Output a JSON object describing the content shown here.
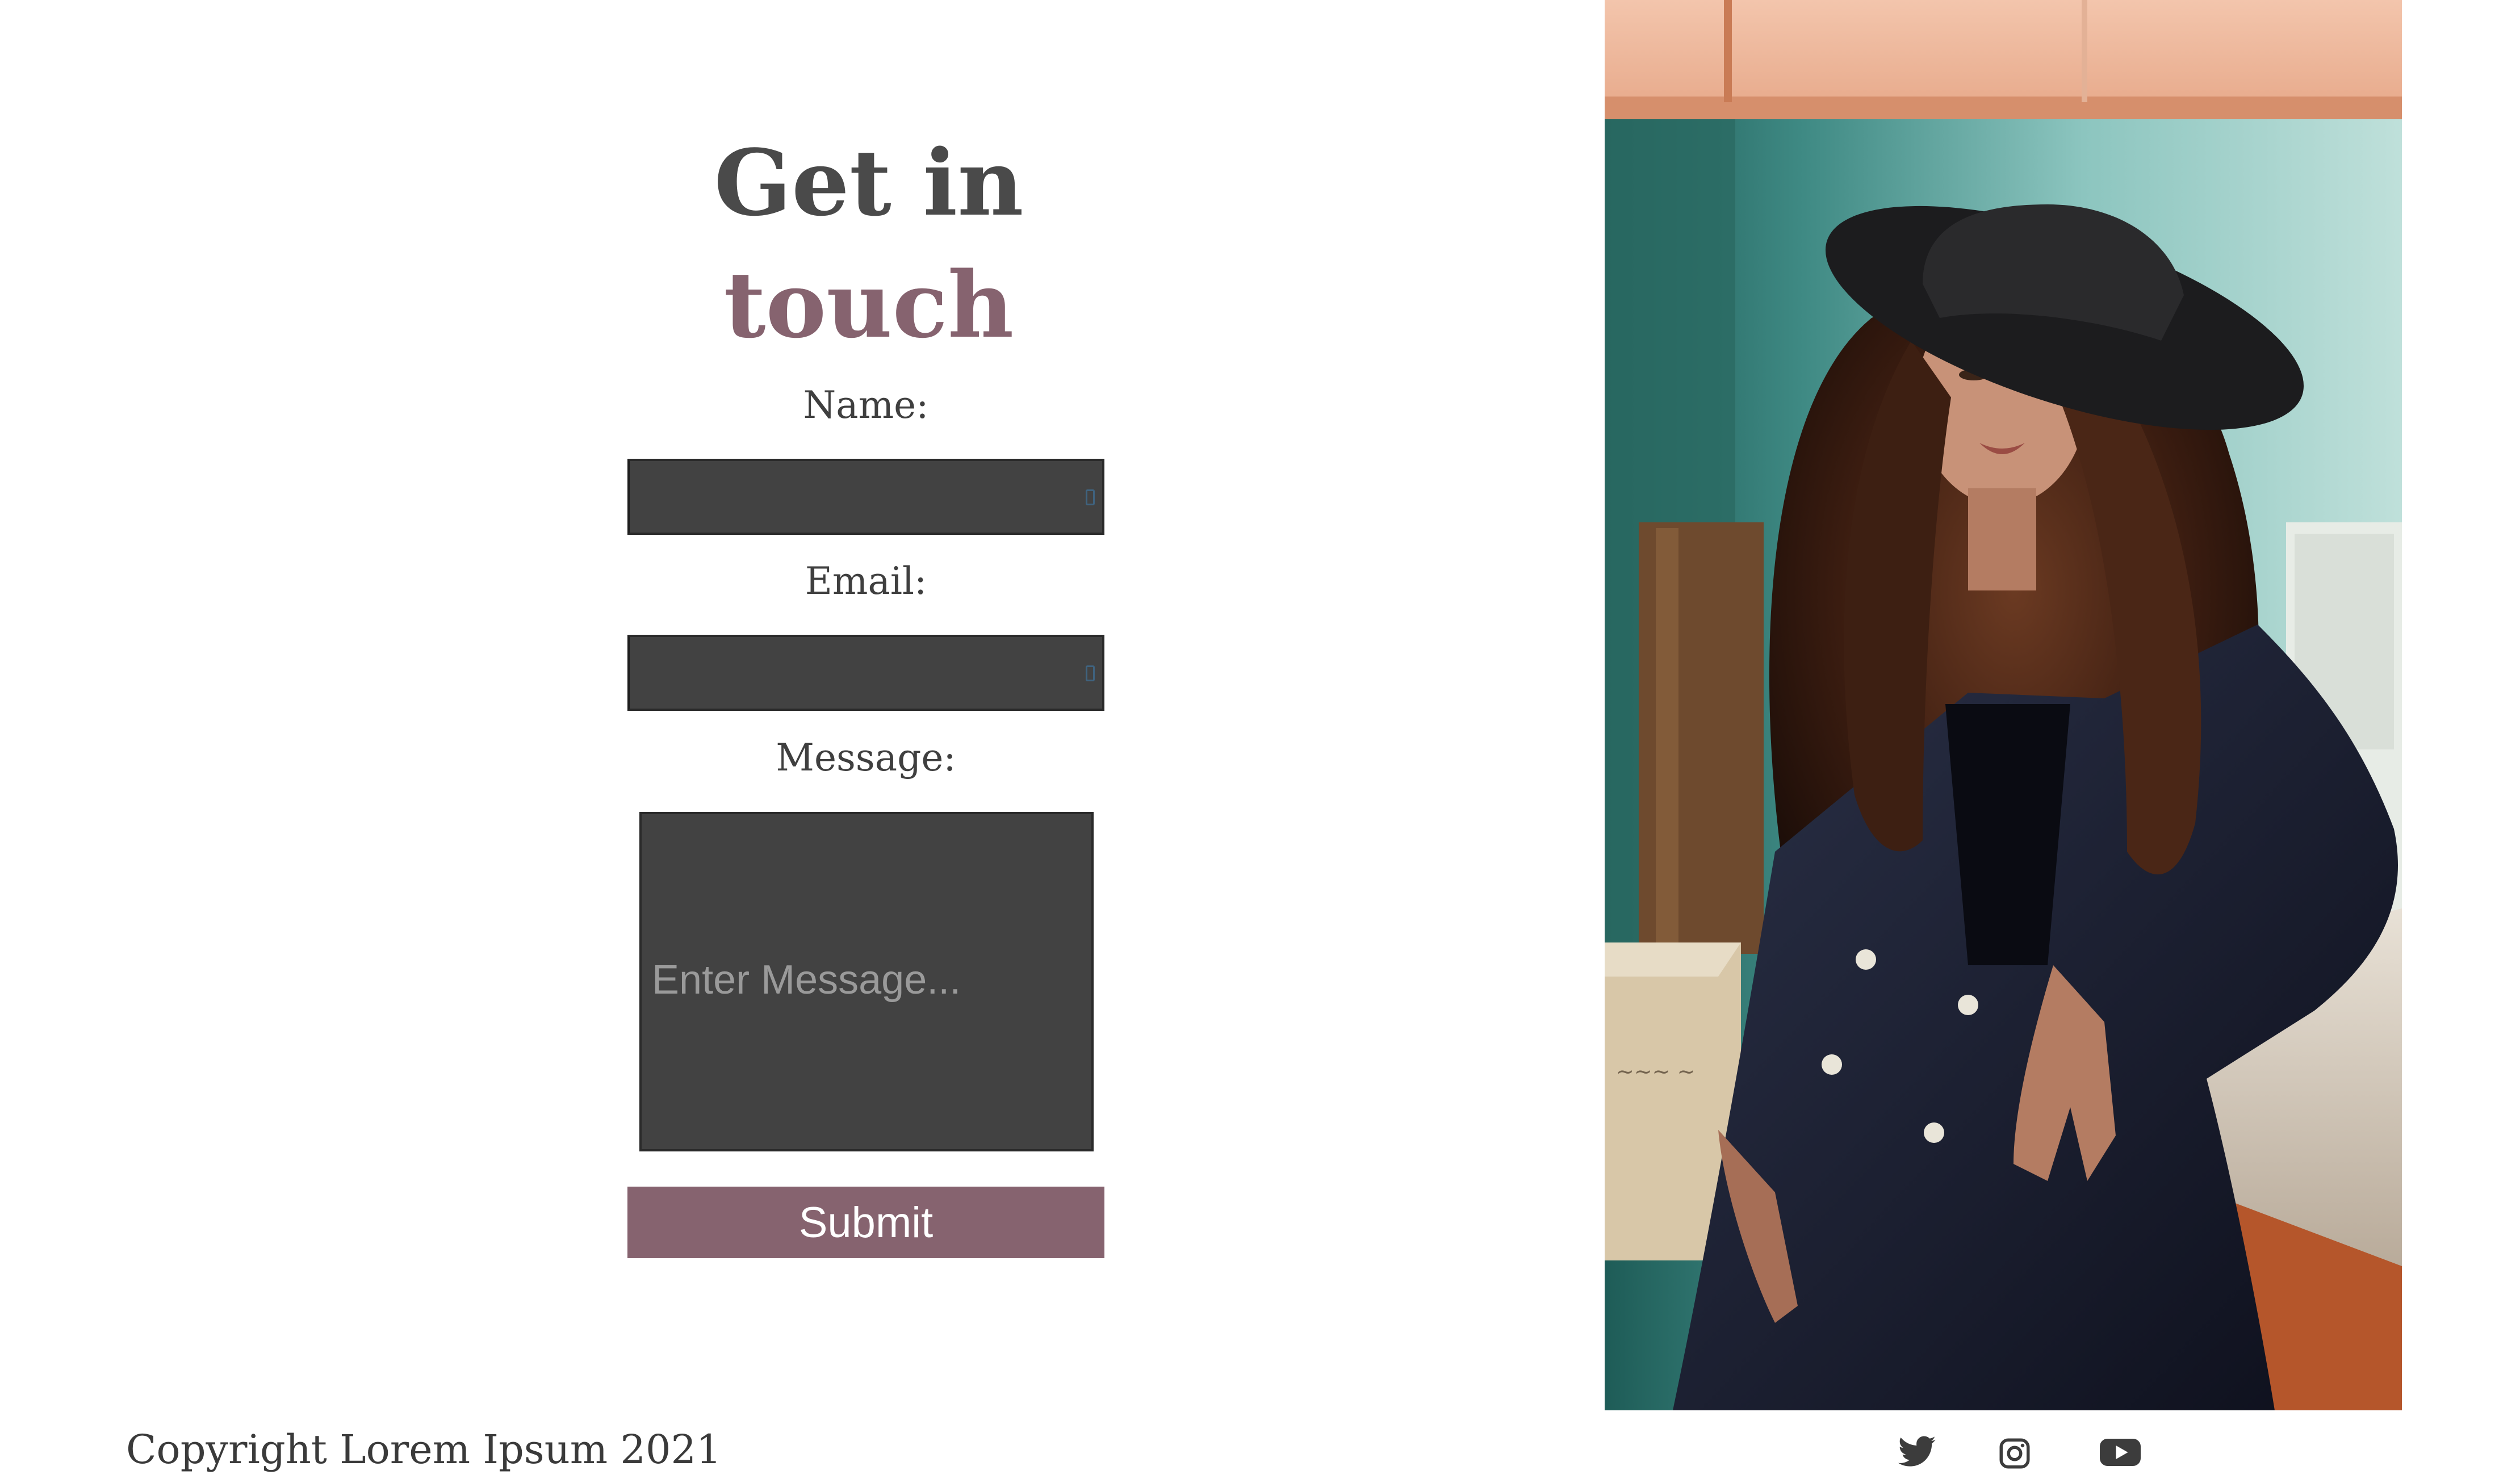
{
  "heading": {
    "line1": "Get in",
    "line2": "touch"
  },
  "form": {
    "name_label": "Name:",
    "email_label": "Email:",
    "message_label": "Message:",
    "message_placeholder": "Enter Message...",
    "name_value": "",
    "email_value": "",
    "submit_label": "Submit"
  },
  "footer": {
    "copyright": "Copyright Lorem Ipsum 2021",
    "social_icons": [
      "twitter-icon",
      "instagram-icon",
      "youtube-icon"
    ]
  },
  "colors": {
    "accent": "#86636f",
    "heading_dark": "#4a4a4a",
    "field_bg": "#424242"
  }
}
